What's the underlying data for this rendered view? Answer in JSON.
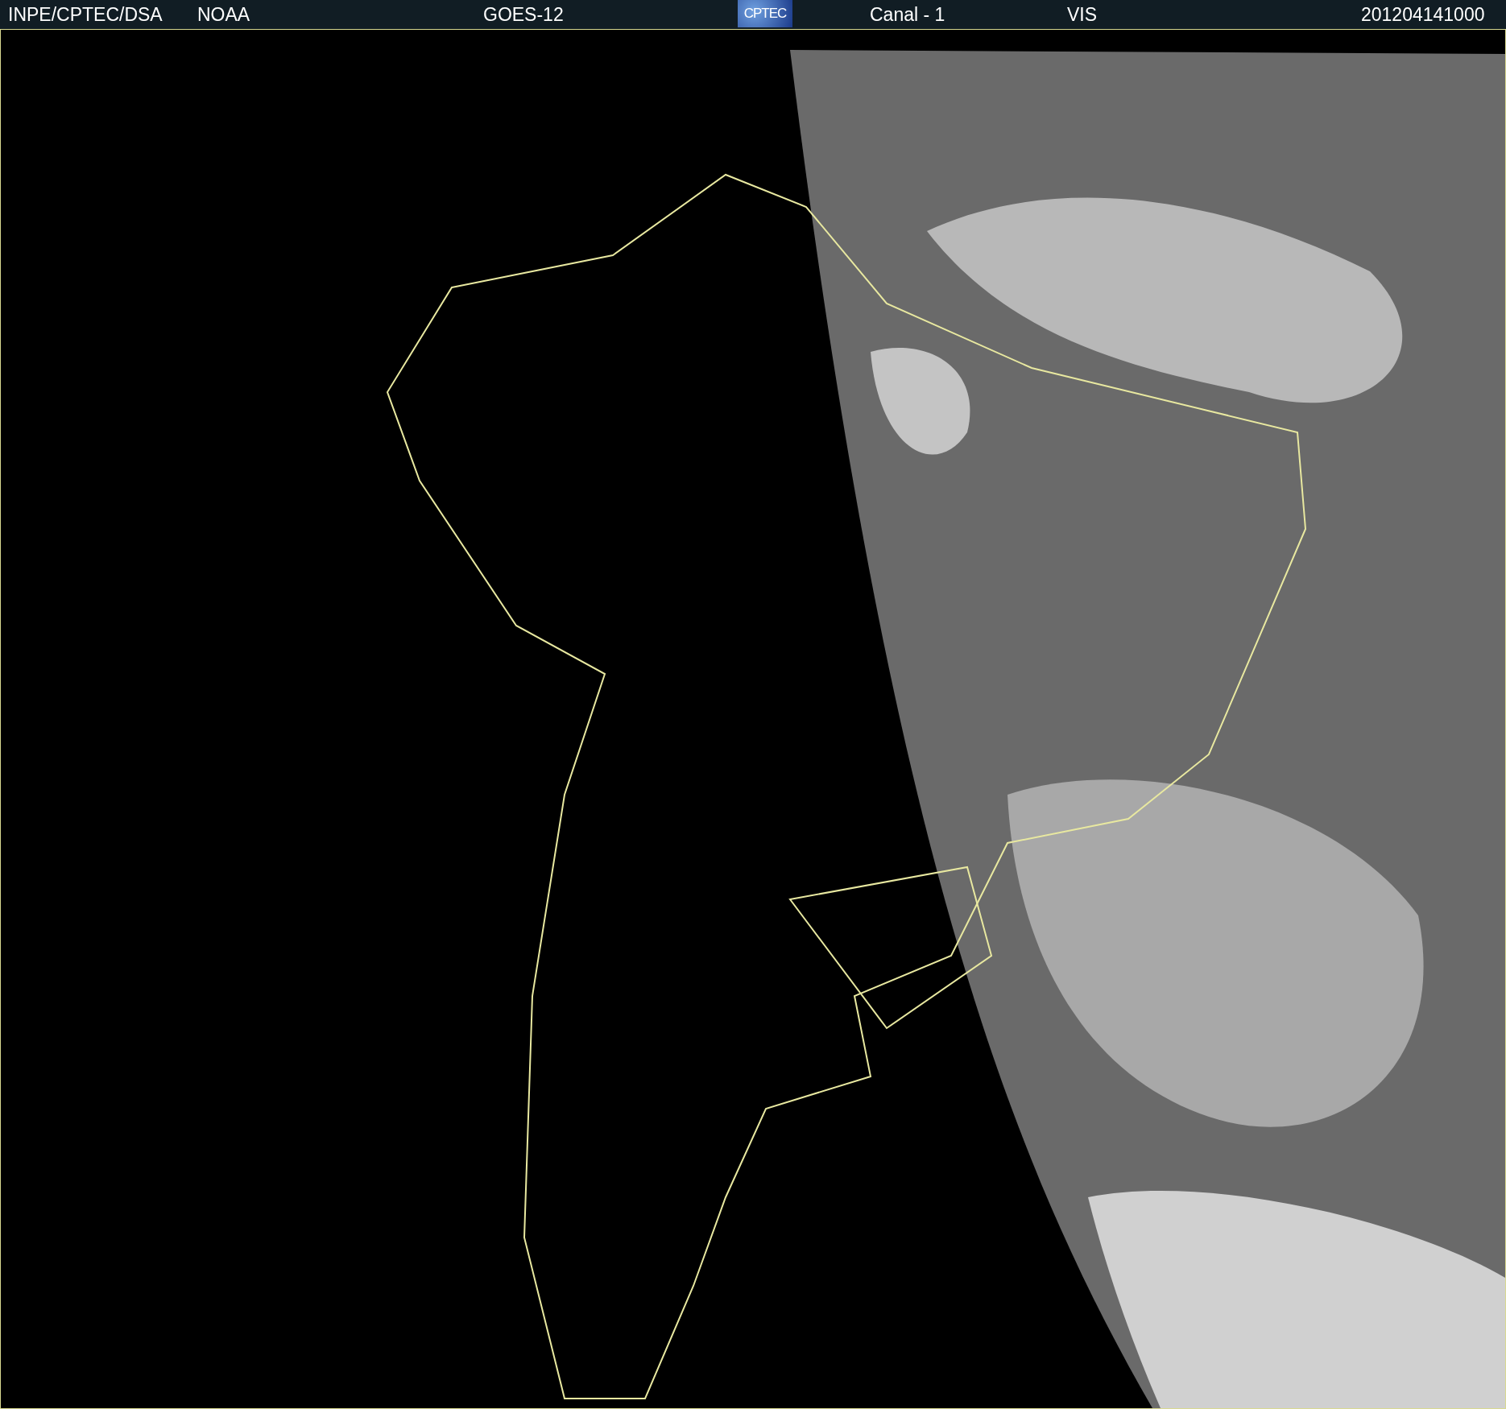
{
  "header": {
    "texts": [
      {
        "kind": "source",
        "text": "INPE/CPTEC/DSA"
      },
      {
        "kind": "agency",
        "text": "NOAA"
      },
      {
        "kind": "satellite",
        "text": "GOES-12"
      },
      {
        "kind": "logo",
        "text": "CPTEC"
      },
      {
        "kind": "channel",
        "text": "Canal - 1"
      },
      {
        "kind": "band",
        "text": "VIS"
      },
      {
        "kind": "timestamp",
        "text": "201204141000"
      }
    ]
  }
}
